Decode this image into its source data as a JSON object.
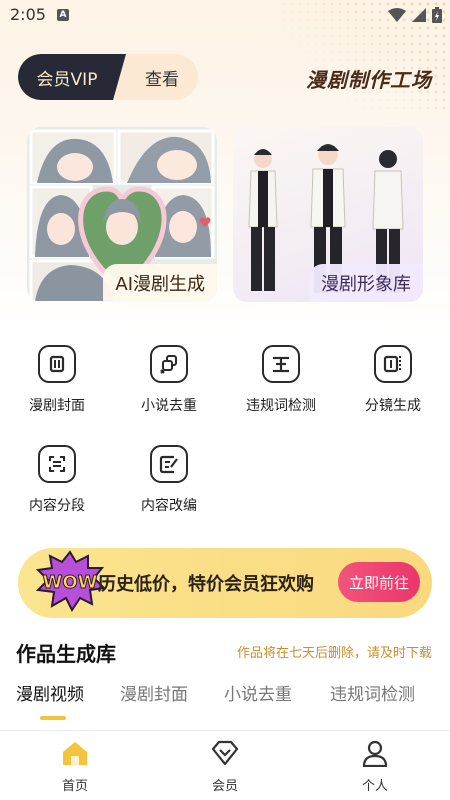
{
  "status_bar": {
    "time": "2:05",
    "notification_letter": "A"
  },
  "header": {
    "vip_tab": "会员VIP",
    "view_tab": "查看",
    "workshop_title": "漫剧制作工场"
  },
  "cards": {
    "ai": {
      "label": "AI漫剧生成"
    },
    "character": {
      "label": "漫剧形象库"
    }
  },
  "tools": [
    {
      "label": "漫剧封面",
      "icon": "cover-icon"
    },
    {
      "label": "小说去重",
      "icon": "dedupe-icon"
    },
    {
      "label": "违规词检测",
      "icon": "word-check-icon"
    },
    {
      "label": "分镜生成",
      "icon": "storyboard-icon"
    },
    {
      "label": "内容分段",
      "icon": "segment-icon"
    },
    {
      "label": "内容改编",
      "icon": "adapt-icon"
    }
  ],
  "promo": {
    "badge": "WOW",
    "text": "历史低价，特价会员狂欢购",
    "button": "立即前往"
  },
  "library": {
    "title": "作品生成库",
    "notice": "作品将在七天后删除，请及时下载",
    "tabs": [
      "漫剧视频",
      "漫剧封面",
      "小说去重",
      "违规词检测"
    ],
    "active_tab": 0
  },
  "bottom_nav": [
    {
      "label": "首页",
      "icon": "home-icon",
      "active": true
    },
    {
      "label": "会员",
      "icon": "member-icon",
      "active": false
    },
    {
      "label": "个人",
      "icon": "profile-icon",
      "active": false
    }
  ],
  "colors": {
    "accent_yellow": "#f3c23b",
    "dark_pill": "#272a36",
    "promo_button": "#e9366c",
    "notice": "#c7902d"
  }
}
